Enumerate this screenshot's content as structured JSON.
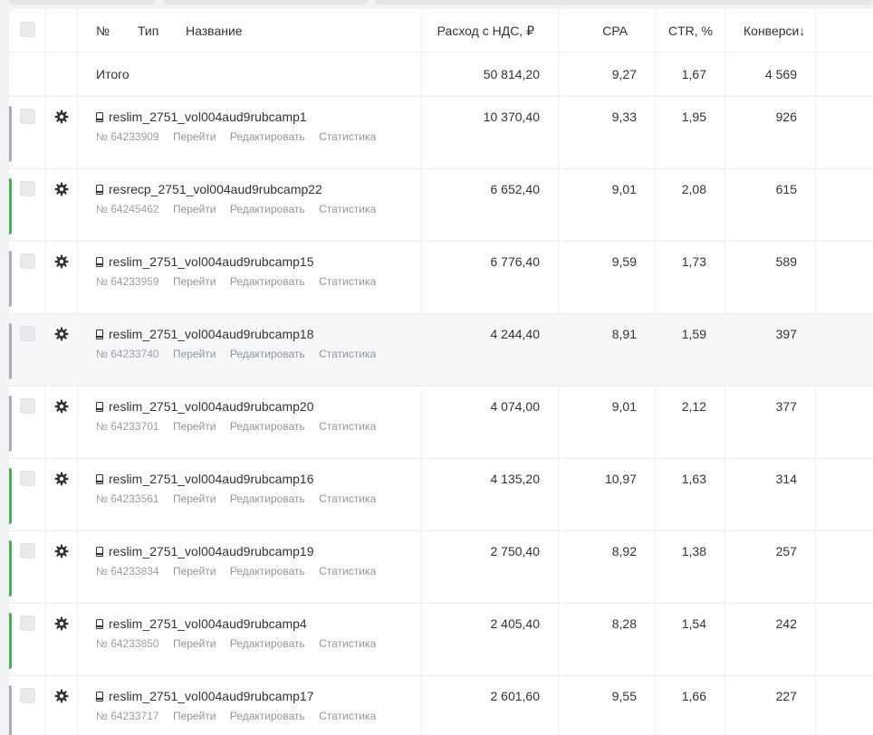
{
  "header": {
    "num": "№",
    "type": "Тип",
    "name": "Название",
    "spend": "Расход с НДС, ₽",
    "cpa": "CPA",
    "ctr": "CTR, %",
    "conv": "Конверси",
    "sort_icon": "↓"
  },
  "total": {
    "label": "Итого",
    "spend": "50 814,20",
    "cpa": "9,27",
    "ctr": "1,67",
    "conv": "4 569"
  },
  "link_labels": {
    "go": "Перейти",
    "edit": "Редактировать",
    "stats": "Статистика"
  },
  "status_colors": {
    "active": "#3db34a",
    "paused": "#a7acb7"
  },
  "icons": {
    "row_settings": "gear-icon",
    "campaign_type": "mobile-phone-icon"
  },
  "campaigns": [
    {
      "name": "reslim_2751_vol004aud9rubcamp1",
      "id": "№ 64233909",
      "spend": "10 370,40",
      "cpa": "9,33",
      "ctr": "1,95",
      "conv": "926",
      "status": "paused"
    },
    {
      "name": "resrecp_2751_vol004aud9rubcamp22",
      "id": "№ 64245462",
      "spend": "6 652,40",
      "cpa": "9,01",
      "ctr": "2,08",
      "conv": "615",
      "status": "active"
    },
    {
      "name": "reslim_2751_vol004aud9rubcamp15",
      "id": "№ 64233959",
      "spend": "6 776,40",
      "cpa": "9,59",
      "ctr": "1,73",
      "conv": "589",
      "status": "paused"
    },
    {
      "name": "reslim_2751_vol004aud9rubcamp18",
      "id": "№ 64233740",
      "spend": "4 244,40",
      "cpa": "8,91",
      "ctr": "1,59",
      "conv": "397",
      "status": "paused"
    },
    {
      "name": "reslim_2751_vol004aud9rubcamp20",
      "id": "№ 64233701",
      "spend": "4 074,00",
      "cpa": "9,01",
      "ctr": "2,12",
      "conv": "377",
      "status": "paused"
    },
    {
      "name": "reslim_2751_vol004aud9rubcamp16",
      "id": "№ 64233561",
      "spend": "4 135,20",
      "cpa": "10,97",
      "ctr": "1,63",
      "conv": "314",
      "status": "active"
    },
    {
      "name": "reslim_2751_vol004aud9rubcamp19",
      "id": "№ 64233834",
      "spend": "2 750,40",
      "cpa": "8,92",
      "ctr": "1,38",
      "conv": "257",
      "status": "active"
    },
    {
      "name": "reslim_2751_vol004aud9rubcamp4",
      "id": "№ 64233850",
      "spend": "2 405,40",
      "cpa": "8,28",
      "ctr": "1,54",
      "conv": "242",
      "status": "active"
    },
    {
      "name": "reslim_2751_vol004aud9rubcamp17",
      "id": "№ 64233717",
      "spend": "2 601,60",
      "cpa": "9,55",
      "ctr": "1,66",
      "conv": "227",
      "status": "paused"
    }
  ]
}
